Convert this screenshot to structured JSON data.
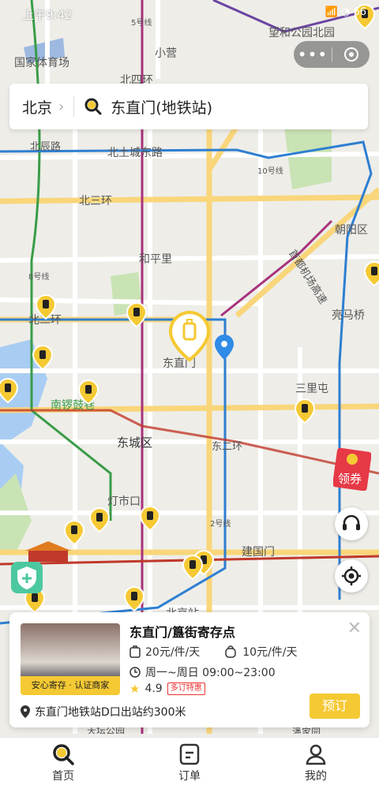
{
  "status_bar": {
    "time": "上午9:42",
    "battery": "66"
  },
  "search": {
    "city": "北京",
    "query": "东直门(地铁站)"
  },
  "map": {
    "labels": [
      {
        "text": "国家体育场"
      },
      {
        "text": "5号线"
      },
      {
        "text": "望和公园北园"
      },
      {
        "text": "小营"
      },
      {
        "text": "北四环"
      },
      {
        "text": "北土城东路"
      },
      {
        "text": "10号线"
      },
      {
        "text": "北辰路"
      },
      {
        "text": "北三环"
      },
      {
        "text": "朝阳区"
      },
      {
        "text": "和平里"
      },
      {
        "text": "首都机场高速"
      },
      {
        "text": "8号线"
      },
      {
        "text": "北二环"
      },
      {
        "text": "亮马桥"
      },
      {
        "text": "东直门"
      },
      {
        "text": "三里屯"
      },
      {
        "text": "南锣鼓巷"
      },
      {
        "text": "东城区"
      },
      {
        "text": "东二环"
      },
      {
        "text": "灯市口"
      },
      {
        "text": "2号线"
      },
      {
        "text": "建国门"
      },
      {
        "text": "北京站"
      },
      {
        "text": "天坛公园"
      },
      {
        "text": "潘家园"
      }
    ]
  },
  "coupon": {
    "label": "领券"
  },
  "card": {
    "title": "东直门/簋街寄存点",
    "thumb_tag": "安心寄存 · 认证商家",
    "price_small": "20元/件/天",
    "price_large": "10元/件/天",
    "hours": "周一~周日 09:00~23:00",
    "rating": "4.9",
    "promo": "多订特惠",
    "book_label": "预订",
    "address": "东直门地铁站D口出站约300米"
  },
  "tabs": [
    {
      "label": "首页",
      "icon": "search-icon"
    },
    {
      "label": "订单",
      "icon": "order-icon"
    },
    {
      "label": "我的",
      "icon": "profile-icon"
    }
  ],
  "colors": {
    "accent": "#f5c933",
    "map_bg": "#eeede8",
    "road": "#ffffff",
    "road_major": "#f9d67a"
  }
}
